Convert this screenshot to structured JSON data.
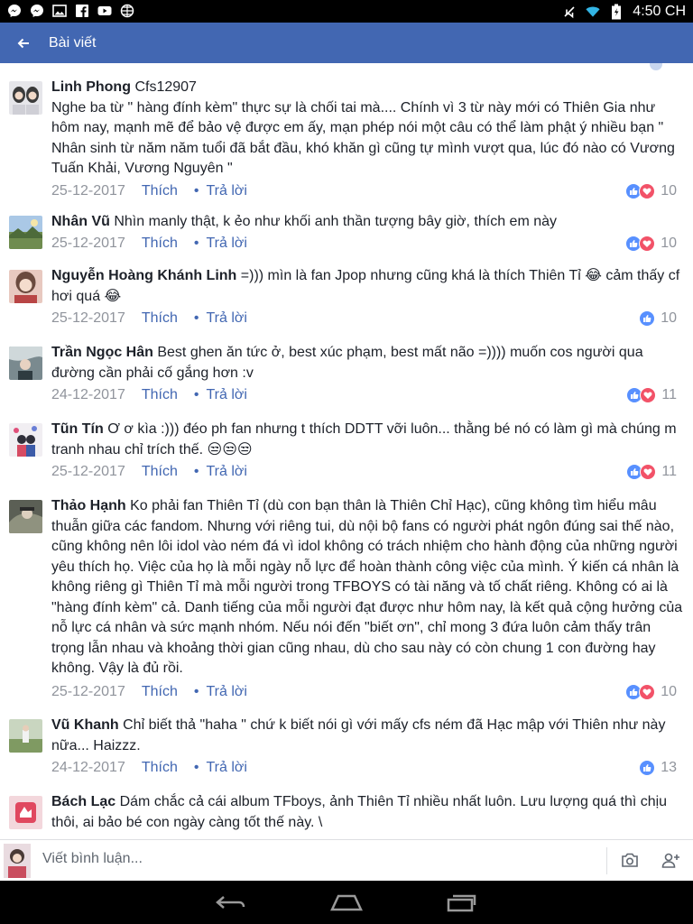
{
  "status_bar": {
    "time": "4:50 CH",
    "left_icons": [
      "messenger-icon",
      "messenger-icon",
      "image-icon",
      "facebook-icon",
      "youtube-icon",
      "browser-icon"
    ],
    "right_icons": [
      "mute-icon",
      "wifi-icon",
      "battery-icon"
    ]
  },
  "header": {
    "title": "Bài viết"
  },
  "comments": [
    {
      "name": "Linh Phong",
      "tag": "Cfs12907",
      "text": "Nghe ba từ \" hàng đính kèm\" thực sự là chối tai mà.... Chính vì 3 từ này mới có Thiên Gia như hôm nay, mạnh mẽ để bảo vệ được em ấy, mạn phép nói một câu có thể làm phật ý nhiều bạn \" Nhân sinh từ năm năm tuổi đã bắt đầu, khó khăn gì cũng tự mình vượt qua, lúc đó nào có Vương Tuấn Khải, Vương Nguyên \"",
      "date": "25-12-2017",
      "like_label": "Thích",
      "reply_label": "Trả lời",
      "reaction_count": "10"
    },
    {
      "name": "Nhân Vũ",
      "text": "Nhìn manly thật, k ẻo như khối anh thần tượng bây giờ, thích em này",
      "date": "25-12-2017",
      "like_label": "Thích",
      "reply_label": "Trả lời",
      "reaction_count": "10"
    },
    {
      "name": "Nguyễn Hoàng Khánh Linh",
      "text": "=))) mìn là fan Jpop nhưng cũng khá là thích Thiên Tỉ 😂 cảm thấy cf hơi quá 😂",
      "date": "25-12-2017",
      "like_label": "Thích",
      "reply_label": "Trả lời",
      "reaction_count": "10"
    },
    {
      "name": "Trần Ngọc Hân",
      "text": "Best ghen ăn tức ở, best xúc phạm, best mất não =)))) muốn cos người qua đường cần phải cố gắng hơn :v",
      "date": "24-12-2017",
      "like_label": "Thích",
      "reply_label": "Trả lời",
      "reaction_count": "11"
    },
    {
      "name": "Tũn Tín",
      "text": "Ơ ơ kìa :))) đéo ph fan nhưng t thích DDTT vỡi luôn... thằng bé nó có làm gì mà chúng m tranh nhau chỉ trích thế. 😒😒😒",
      "date": "25-12-2017",
      "like_label": "Thích",
      "reply_label": "Trả lời",
      "reaction_count": "11"
    },
    {
      "name": "Thảo Hạnh",
      "text": "Ko phải fan Thiên Tỉ (dù con bạn thân là Thiên Chỉ Hạc), cũng không tìm hiểu mâu thuẫn giữa các fandom. Nhưng với riêng tui, dù nội bộ fans có người phát ngôn đúng sai thế nào, cũng không nên lôi idol vào ném đá vì idol không có trách nhiệm cho hành động của những người yêu thích họ. Việc của họ là mỗi ngày nỗ lực để hoàn thành công việc của mình. Ý kiến cá nhân là không riêng gì Thiên Tỉ mà mỗi người trong TFBOYS có tài năng và tố chất riêng. Không có ai là \"hàng đính kèm\" cả. Danh tiếng của mỗi người đạt được như hôm nay, là kết quả cộng hưởng của nỗ lực cá nhân và sức mạnh nhóm. Nếu nói đến \"biết ơn\", chỉ mong 3 đứa luôn cảm thấy trân trọng lẫn nhau và khoảng thời gian cũng nhau, dù cho sau này có còn chung 1 con đường hay không. Vậy là đủ rồi.",
      "date": "25-12-2017",
      "like_label": "Thích",
      "reply_label": "Trả lời",
      "reaction_count": "10"
    },
    {
      "name": "Vũ Khanh",
      "text": "Chỉ biết thả \"haha \" chứ k biết nói gì với mấy cfs ném đã Hạc mập với Thiên như này nữa...  Haizzz.",
      "date": "24-12-2017",
      "like_label": "Thích",
      "reply_label": "Trả lời",
      "reaction_count": "13"
    },
    {
      "name": "Bách Lạc",
      "text": "Dám chắc cả cái album TFboys, ảnh Thiên Tỉ nhiều nhất luôn. Lưu lượng quá thì chịu thôi, ai bảo bé con ngày càng tốt thế này. \\"
    }
  ],
  "composer": {
    "placeholder": "Viết bình luận..."
  },
  "colors": {
    "brand": "#4267b2",
    "like": "#5890ff",
    "love": "#f25268"
  }
}
